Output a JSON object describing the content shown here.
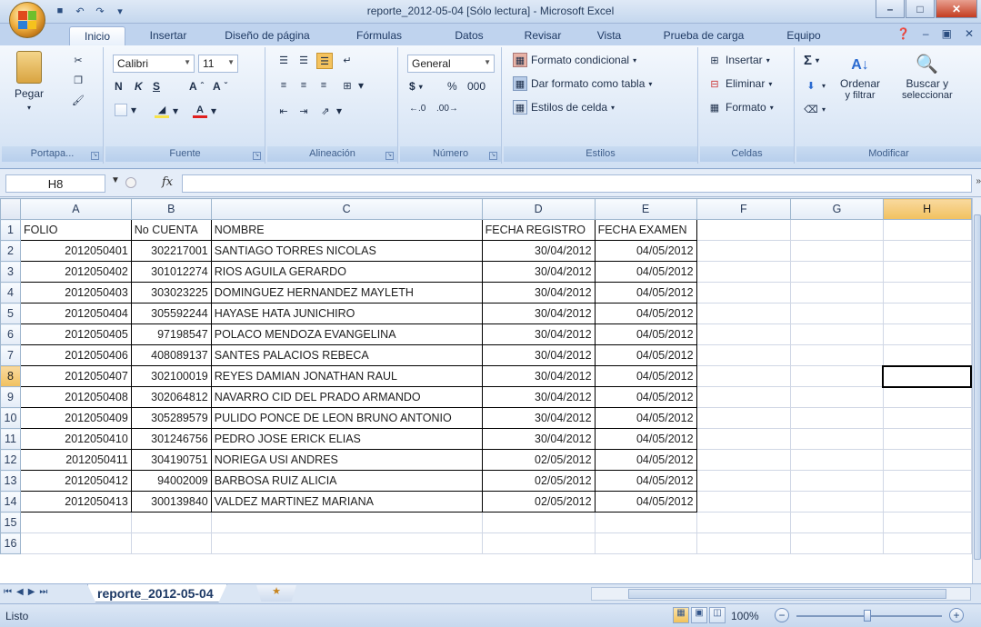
{
  "window": {
    "title": "reporte_2012-05-04  [Sólo lectura] - Microsoft Excel",
    "controls": [
      "minimize",
      "maximize",
      "close"
    ]
  },
  "ribbon": {
    "tabs": [
      "Inicio",
      "Insertar",
      "Diseño de página",
      "Fórmulas",
      "Datos",
      "Revisar",
      "Vista",
      "Prueba de carga",
      "Equipo"
    ],
    "active_tab": "Inicio",
    "groups": {
      "portapapeles": {
        "label": "Portapa...",
        "paste": "Pegar"
      },
      "fuente": {
        "label": "Fuente",
        "font_name": "Calibri",
        "font_size": "11",
        "bold": "N",
        "italic": "K",
        "underline": "S"
      },
      "alineacion": {
        "label": "Alineación"
      },
      "numero": {
        "label": "Número",
        "format": "General",
        "currency": "$",
        "percent": "%",
        "thousands": "000"
      },
      "estilos": {
        "label": "Estilos",
        "cond_format": "Formato condicional",
        "table_format": "Dar formato como tabla",
        "cell_styles": "Estilos de celda"
      },
      "celdas": {
        "label": "Celdas",
        "insert": "Insertar",
        "delete": "Eliminar",
        "format": "Formato"
      },
      "modificar": {
        "label": "Modificar",
        "sum": "Σ",
        "sort_line1": "Ordenar",
        "sort_line2": "y filtrar",
        "find_line1": "Buscar y",
        "find_line2": "seleccionar"
      }
    }
  },
  "formula_bar": {
    "name_box": "H8",
    "fx": "fx",
    "content": ""
  },
  "sheet": {
    "columns": [
      "A",
      "B",
      "C",
      "D",
      "E",
      "F",
      "G",
      "H"
    ],
    "selected_column": "H",
    "selected_row": "8",
    "row_numbers": [
      "1",
      "2",
      "3",
      "4",
      "5",
      "6",
      "7",
      "8",
      "9",
      "10",
      "11",
      "12",
      "13",
      "14",
      "15",
      "16"
    ],
    "header_row": [
      "FOLIO",
      "No CUENTA",
      "NOMBRE",
      "FECHA REGISTRO",
      "FECHA EXAMEN"
    ],
    "rows": [
      [
        "2012050401",
        "302217001",
        "SANTIAGO TORRES NICOLAS",
        "30/04/2012",
        "04/05/2012"
      ],
      [
        "2012050402",
        "301012274",
        "RIOS AGUILA GERARDO",
        "30/04/2012",
        "04/05/2012"
      ],
      [
        "2012050403",
        "303023225",
        "DOMINGUEZ HERNANDEZ MAYLETH",
        "30/04/2012",
        "04/05/2012"
      ],
      [
        "2012050404",
        "305592244",
        "HAYASE HATA JUNICHIRO",
        "30/04/2012",
        "04/05/2012"
      ],
      [
        "2012050405",
        "97198547",
        "POLACO MENDOZA EVANGELINA",
        "30/04/2012",
        "04/05/2012"
      ],
      [
        "2012050406",
        "408089137",
        "SANTES PALACIOS REBECA",
        "30/04/2012",
        "04/05/2012"
      ],
      [
        "2012050407",
        "302100019",
        "REYES DAMIAN JONATHAN RAUL",
        "30/04/2012",
        "04/05/2012"
      ],
      [
        "2012050408",
        "302064812",
        "NAVARRO CID DEL PRADO ARMANDO",
        "30/04/2012",
        "04/05/2012"
      ],
      [
        "2012050409",
        "305289579",
        "PULIDO PONCE DE LEON BRUNO ANTONIO",
        "30/04/2012",
        "04/05/2012"
      ],
      [
        "2012050410",
        "301246756",
        "PEDRO JOSE ERICK ELIAS",
        "30/04/2012",
        "04/05/2012"
      ],
      [
        "2012050411",
        "304190751",
        "NORIEGA USI ANDRES",
        "02/05/2012",
        "04/05/2012"
      ],
      [
        "2012050412",
        "94002009",
        "BARBOSA RUIZ ALICIA",
        "02/05/2012",
        "04/05/2012"
      ],
      [
        "2012050413",
        "300139840",
        "VALDEZ MARTINEZ MARIANA",
        "02/05/2012",
        "04/05/2012"
      ]
    ]
  },
  "sheet_tab": "reporte_2012-05-04",
  "status": {
    "text": "Listo",
    "zoom": "100%"
  },
  "colors": {
    "ribbon_bg": "#dbe7f6",
    "selected_header": "#f1c15f",
    "accent": "#1e3a66"
  }
}
